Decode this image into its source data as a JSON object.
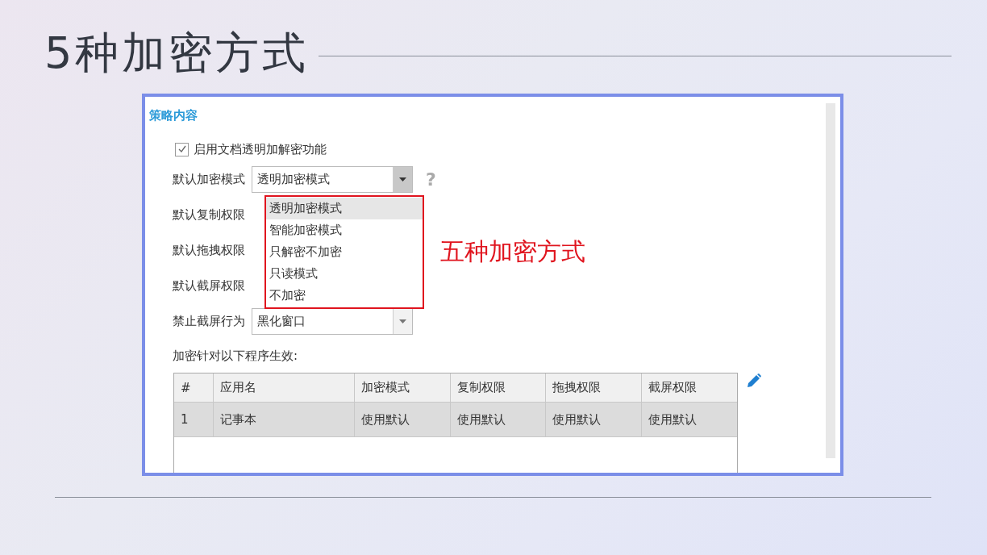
{
  "slide": {
    "title": "5种加密方式"
  },
  "panel": {
    "heading": "策略内容",
    "enable": {
      "label": "启用文档透明加解密功能",
      "checked": true
    },
    "fields": [
      {
        "label": "默认加密模式",
        "value": "透明加密模式",
        "open": true,
        "help": "?",
        "options": [
          {
            "label": "透明加密模式",
            "selected": true
          },
          {
            "label": "智能加密模式",
            "selected": false
          },
          {
            "label": "只解密不加密",
            "selected": false
          },
          {
            "label": "只读模式",
            "selected": false
          },
          {
            "label": "不加密",
            "selected": false
          }
        ]
      },
      {
        "label": "默认复制权限"
      },
      {
        "label": "默认拖拽权限"
      },
      {
        "label": "默认截屏权限"
      },
      {
        "label": "禁止截屏行为",
        "value": "黑化窗口",
        "open": false
      }
    ],
    "table_caption": "加密针对以下程序生效:",
    "table": {
      "columns": [
        "#",
        "应用名",
        "加密模式",
        "复制权限",
        "拖拽权限",
        "截屏权限"
      ],
      "rows": [
        [
          "1",
          "记事本",
          "使用默认",
          "使用默认",
          "使用默认",
          "使用默认"
        ]
      ]
    }
  },
  "annotation": "五种加密方式"
}
